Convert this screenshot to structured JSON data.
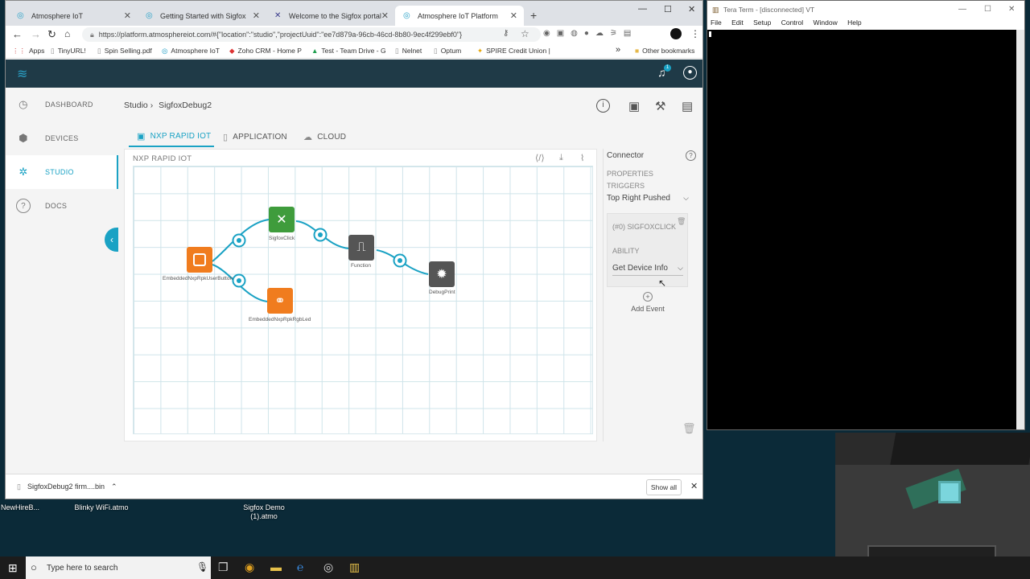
{
  "browser": {
    "tabs": [
      {
        "label": "Atmosphere IoT",
        "active": false
      },
      {
        "label": "Getting Started with Sigfox",
        "active": false
      },
      {
        "label": "Welcome to the Sigfox portal",
        "active": false
      },
      {
        "label": "Atmosphere IoT Platform",
        "active": true
      }
    ],
    "url": "https://platform.atmosphereiot.com/#{\"location\":\"studio\",\"projectUuid\":\"ee7d879a-96cb-46cd-8b80-9ec4f299ebf0\"}",
    "bookmarks": [
      "Apps",
      "TinyURL!",
      "Spin Selling.pdf",
      "Atmosphere IoT",
      "Zoho CRM - Home P",
      "Test - Team Drive - G",
      "Nelnet",
      "Optum",
      "SPIRE Credit Union |"
    ],
    "other_bookmarks": "Other bookmarks"
  },
  "header": {
    "notification_count": "1"
  },
  "sidebar": {
    "items": [
      {
        "label": "DASHBOARD",
        "icon": "dashboard-gauge-icon"
      },
      {
        "label": "DEVICES",
        "icon": "cube-icon"
      },
      {
        "label": "STUDIO",
        "icon": "network-icon"
      },
      {
        "label": "DOCS",
        "icon": "help-circle-icon"
      }
    ]
  },
  "studio": {
    "breadcrumb_root": "Studio ›",
    "project_name": "SigfoxDebug2",
    "tabs": [
      {
        "label": "NXP RAPID IOT",
        "active": true
      },
      {
        "label": "APPLICATION",
        "active": false
      },
      {
        "label": "CLOUD",
        "active": false
      }
    ],
    "canvas_title": "NXP RAPID IOT",
    "nodes": [
      {
        "label": "EmbeddedNxpRpkUserButton",
        "color": "#f07c1e"
      },
      {
        "label": "SigfoxClick",
        "color": "#3f9c3c"
      },
      {
        "label": "EmbeddedNxpRpkRgbLed",
        "color": "#f07c1e"
      },
      {
        "label": "Function",
        "color": "#555555"
      },
      {
        "label": "DebugPrint",
        "color": "#555555"
      }
    ]
  },
  "connector": {
    "title": "Connector",
    "properties_label": "PROPERTIES",
    "triggers_label": "TRIGGERS",
    "trigger_value": "Top Right Pushed",
    "event_target": "(#0) SIGFOXCLICK",
    "ability_label": "ABILITY",
    "ability_value": "Get Device Info",
    "add_event": "Add Event"
  },
  "downloads": {
    "file": "SigfoxDebug2 firm....bin",
    "show_all": "Show all"
  },
  "teraterm": {
    "title": "Tera Term - [disconnected] VT",
    "menu": [
      "File",
      "Edit",
      "Setup",
      "Control",
      "Window",
      "Help"
    ]
  },
  "desktop": {
    "icons": [
      "NewHireB...",
      "Blinky WiFi.atmo",
      "Sigfox Demo (1).atmo"
    ]
  },
  "taskbar": {
    "search_placeholder": "Type here to search"
  },
  "colors": {
    "accent": "#1aa2c4",
    "header": "#1f3a47"
  }
}
